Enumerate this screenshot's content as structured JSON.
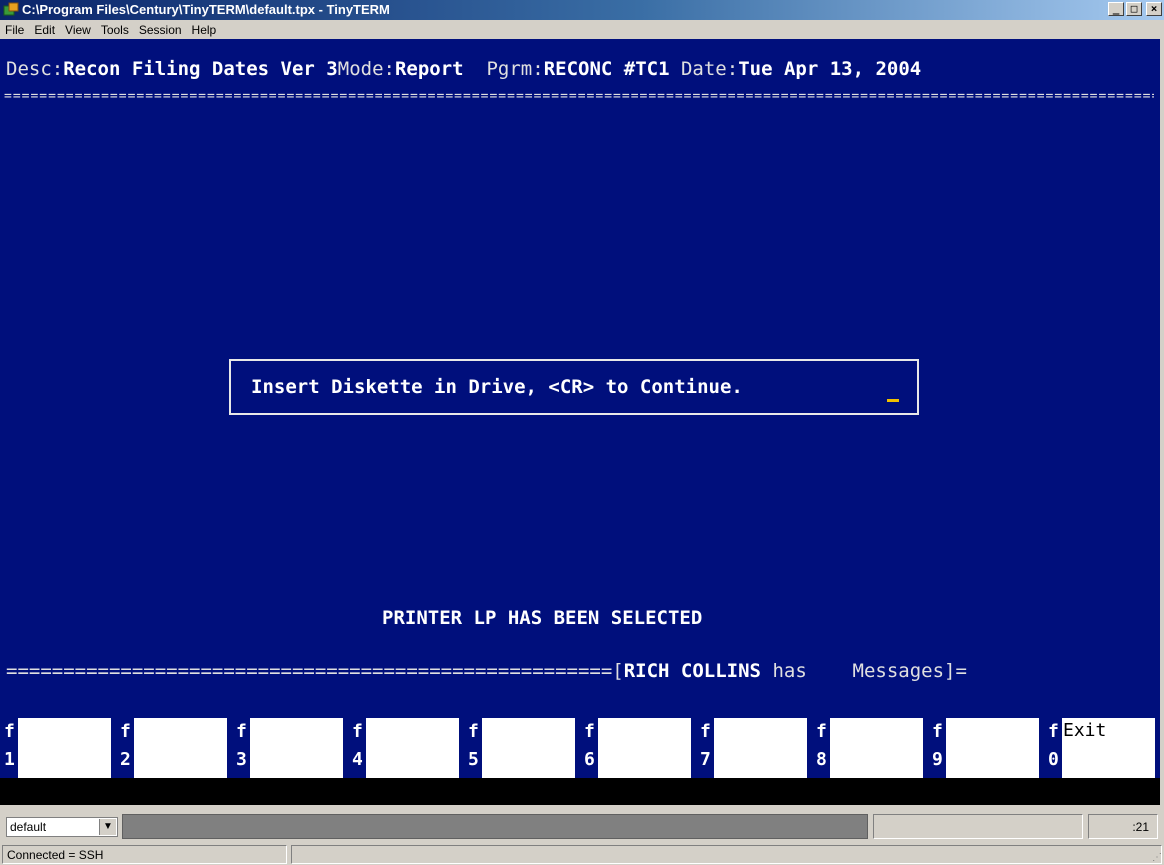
{
  "window": {
    "title": "C:\\Program Files\\Century\\TinyTERM\\default.tpx - TinyTERM",
    "icon": "tinyterm-app-icon",
    "buttons": [
      "_",
      "□",
      "×"
    ]
  },
  "menu": [
    "File",
    "Edit",
    "View",
    "Tools",
    "Session",
    "Help"
  ],
  "header": {
    "desc_label": "Desc:",
    "desc_value": "Recon Filing Dates Ver 3",
    "mode_label": "Mode:",
    "mode_value": "Report",
    "pgrm_label": "Pgrm:",
    "pgrm_value": "RECONC #TC1",
    "date_label": "Date:",
    "date_value": "Tue Apr 13, 2004"
  },
  "rule_char": "====================================================================================================================================",
  "dialog": {
    "message": "Insert Diskette in Drive, <CR> to Continue."
  },
  "printer_message": "PRINTER LP HAS BEEN SELECTED",
  "message_line": {
    "prefix": "=====================================================[",
    "user": "RICH COLLINS",
    "has": " has",
    "messages": "Messages]="
  },
  "fkeys": [
    {
      "key": "f",
      "num": "1",
      "label": ""
    },
    {
      "key": "f",
      "num": "2",
      "label": ""
    },
    {
      "key": "f",
      "num": "3",
      "label": ""
    },
    {
      "key": "f",
      "num": "4",
      "label": ""
    },
    {
      "key": "f",
      "num": "5",
      "label": ""
    },
    {
      "key": "f",
      "num": "6",
      "label": ""
    },
    {
      "key": "f",
      "num": "7",
      "label": ""
    },
    {
      "key": "f",
      "num": "8",
      "label": ""
    },
    {
      "key": "f",
      "num": "9",
      "label": ""
    },
    {
      "key": "f",
      "num": "0",
      "label": "Exit"
    }
  ],
  "statusbar": {
    "session": "default",
    "position": ":21",
    "connection": "Connected = SSH"
  },
  "colors": {
    "terminal_bg": "#000f7c",
    "cursor": "#f0c000"
  }
}
